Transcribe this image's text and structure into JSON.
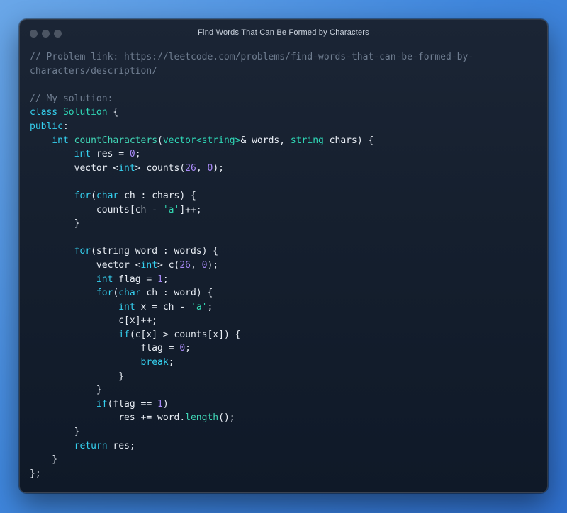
{
  "window": {
    "title": "Find Words That Can Be Formed by Characters"
  },
  "theme": {
    "comment": "#6f7d90",
    "keyword": "#35d0ef",
    "type": "#2fd8b7",
    "function": "#40d6b6",
    "number": "#a98af8",
    "string": "#34d8b1",
    "plain": "#e8edf4"
  },
  "code": {
    "lines": [
      [
        {
          "c": "comment",
          "t": "// Problem link: https://leetcode.com/problems/find-words-that-can-be-formed-by-"
        }
      ],
      [
        {
          "c": "comment",
          "t": "characters/description/"
        }
      ],
      [],
      [
        {
          "c": "comment",
          "t": "// My solution:"
        }
      ],
      [
        {
          "c": "kw",
          "t": "class"
        },
        {
          "c": "plain",
          "t": " "
        },
        {
          "c": "type",
          "t": "Solution"
        },
        {
          "c": "plain",
          "t": " {"
        }
      ],
      [
        {
          "c": "kw",
          "t": "public"
        },
        {
          "c": "plain",
          "t": ":"
        }
      ],
      [
        {
          "c": "plain",
          "t": "    "
        },
        {
          "c": "kw",
          "t": "int"
        },
        {
          "c": "plain",
          "t": " "
        },
        {
          "c": "fn",
          "t": "countCharacters"
        },
        {
          "c": "plain",
          "t": "("
        },
        {
          "c": "type",
          "t": "vector<string>"
        },
        {
          "c": "plain",
          "t": "& words, "
        },
        {
          "c": "type",
          "t": "string"
        },
        {
          "c": "plain",
          "t": " chars) {"
        }
      ],
      [
        {
          "c": "plain",
          "t": "        "
        },
        {
          "c": "kw",
          "t": "int"
        },
        {
          "c": "plain",
          "t": " res = "
        },
        {
          "c": "num",
          "t": "0"
        },
        {
          "c": "plain",
          "t": ";"
        }
      ],
      [
        {
          "c": "plain",
          "t": "        vector <"
        },
        {
          "c": "kw",
          "t": "int"
        },
        {
          "c": "plain",
          "t": "> counts("
        },
        {
          "c": "num",
          "t": "26"
        },
        {
          "c": "plain",
          "t": ", "
        },
        {
          "c": "num",
          "t": "0"
        },
        {
          "c": "plain",
          "t": ");"
        }
      ],
      [],
      [
        {
          "c": "plain",
          "t": "        "
        },
        {
          "c": "kw",
          "t": "for"
        },
        {
          "c": "plain",
          "t": "("
        },
        {
          "c": "kw",
          "t": "char"
        },
        {
          "c": "plain",
          "t": " ch : chars) {"
        }
      ],
      [
        {
          "c": "plain",
          "t": "            counts[ch - "
        },
        {
          "c": "str",
          "t": "'a'"
        },
        {
          "c": "plain",
          "t": "]++;"
        }
      ],
      [
        {
          "c": "plain",
          "t": "        }"
        }
      ],
      [],
      [
        {
          "c": "plain",
          "t": "        "
        },
        {
          "c": "kw",
          "t": "for"
        },
        {
          "c": "plain",
          "t": "(string word : words) {"
        }
      ],
      [
        {
          "c": "plain",
          "t": "            vector <"
        },
        {
          "c": "kw",
          "t": "int"
        },
        {
          "c": "plain",
          "t": "> c("
        },
        {
          "c": "num",
          "t": "26"
        },
        {
          "c": "plain",
          "t": ", "
        },
        {
          "c": "num",
          "t": "0"
        },
        {
          "c": "plain",
          "t": ");"
        }
      ],
      [
        {
          "c": "plain",
          "t": "            "
        },
        {
          "c": "kw",
          "t": "int"
        },
        {
          "c": "plain",
          "t": " flag = "
        },
        {
          "c": "num",
          "t": "1"
        },
        {
          "c": "plain",
          "t": ";"
        }
      ],
      [
        {
          "c": "plain",
          "t": "            "
        },
        {
          "c": "kw",
          "t": "for"
        },
        {
          "c": "plain",
          "t": "("
        },
        {
          "c": "kw",
          "t": "char"
        },
        {
          "c": "plain",
          "t": " ch : word) {"
        }
      ],
      [
        {
          "c": "plain",
          "t": "                "
        },
        {
          "c": "kw",
          "t": "int"
        },
        {
          "c": "plain",
          "t": " x = ch - "
        },
        {
          "c": "str",
          "t": "'a'"
        },
        {
          "c": "plain",
          "t": ";"
        }
      ],
      [
        {
          "c": "plain",
          "t": "                c[x]++;"
        }
      ],
      [
        {
          "c": "plain",
          "t": "                "
        },
        {
          "c": "kw",
          "t": "if"
        },
        {
          "c": "plain",
          "t": "(c[x] > counts[x]) {"
        }
      ],
      [
        {
          "c": "plain",
          "t": "                    flag = "
        },
        {
          "c": "num",
          "t": "0"
        },
        {
          "c": "plain",
          "t": ";"
        }
      ],
      [
        {
          "c": "plain",
          "t": "                    "
        },
        {
          "c": "kw",
          "t": "break"
        },
        {
          "c": "plain",
          "t": ";"
        }
      ],
      [
        {
          "c": "plain",
          "t": "                }"
        }
      ],
      [
        {
          "c": "plain",
          "t": "            }"
        }
      ],
      [
        {
          "c": "plain",
          "t": "            "
        },
        {
          "c": "kw",
          "t": "if"
        },
        {
          "c": "plain",
          "t": "(flag == "
        },
        {
          "c": "num",
          "t": "1"
        },
        {
          "c": "plain",
          "t": ")"
        }
      ],
      [
        {
          "c": "plain",
          "t": "                res += word."
        },
        {
          "c": "fn",
          "t": "length"
        },
        {
          "c": "plain",
          "t": "();"
        }
      ],
      [
        {
          "c": "plain",
          "t": "        }"
        }
      ],
      [
        {
          "c": "plain",
          "t": "        "
        },
        {
          "c": "kw",
          "t": "return"
        },
        {
          "c": "plain",
          "t": " res;"
        }
      ],
      [
        {
          "c": "plain",
          "t": "    }"
        }
      ],
      [
        {
          "c": "plain",
          "t": "};"
        }
      ]
    ]
  }
}
